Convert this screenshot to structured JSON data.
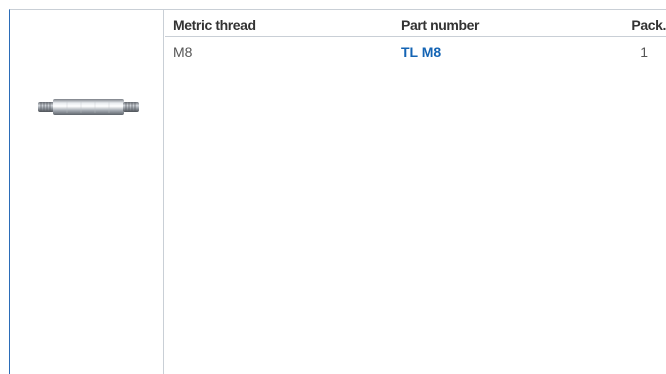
{
  "table": {
    "headers": {
      "metric_thread": "Metric thread",
      "part_number": "Part number",
      "pack": "Pack."
    },
    "rows": [
      {
        "metric_thread": "M8",
        "part_number": "TL M8",
        "pack": "1"
      }
    ]
  },
  "product_image": {
    "icon": "threaded-pin-icon"
  },
  "colors": {
    "accent_blue": "#1464b4",
    "border_blue": "#2b6cb8",
    "grid_gray": "#c9cfd6",
    "text_dark": "#333333"
  }
}
